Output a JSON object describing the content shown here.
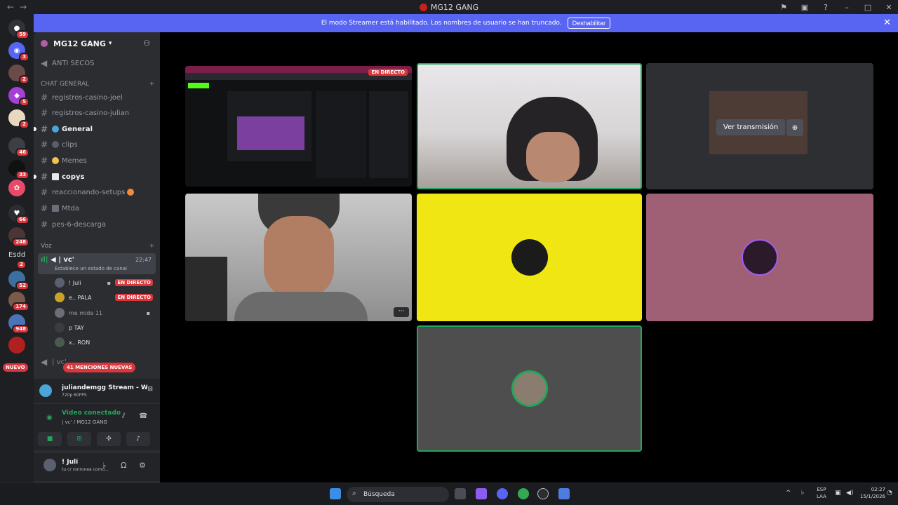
{
  "window": {
    "title": "MG12 GANG"
  },
  "banner": {
    "text": "El modo Streamer está habilitado. Los nombres de usuario se han truncado.",
    "button": "Deshabilitar"
  },
  "servers": {
    "badges": [
      "59",
      "3",
      "2",
      "5",
      "2",
      "46",
      "33",
      "66",
      "248",
      "2",
      "52",
      "174",
      "948"
    ],
    "text_server": "Esdd",
    "nuevo": "NUEVO"
  },
  "server": {
    "name": "MG12 GANG"
  },
  "channels": {
    "top": "ANTI SECOS",
    "category_chat": "CHAT GENERAL",
    "list": [
      {
        "label": "registros-casino-joel",
        "unread": false
      },
      {
        "label": "registros-casino-julian",
        "unread": false
      },
      {
        "label": "General",
        "unread": true
      },
      {
        "label": "clips",
        "unread": false
      },
      {
        "label": "Memes",
        "unread": false
      },
      {
        "label": "copys",
        "unread": true
      },
      {
        "label": "reaccionando-setups",
        "unread": false
      },
      {
        "label": "Mtda",
        "unread": false
      },
      {
        "label": "pes-6-descarga",
        "unread": false
      }
    ],
    "category_voice": "Voz"
  },
  "voice_channel": {
    "name": "| vc'",
    "time": "22:47",
    "status": "Establece un estado de canal",
    "next": "| vc'"
  },
  "voice_users": [
    {
      "name": "! Juli",
      "live": "EN DIRECTO",
      "color": "#5b6070"
    },
    {
      "name": "e.. PALA",
      "live": "EN DIRECTO",
      "color": "#c9a227"
    },
    {
      "name": "me mide 11",
      "live": "",
      "color": "#6d6f78"
    },
    {
      "name": "p TAY",
      "live": "",
      "color": "#3a3c42"
    },
    {
      "name": "x.. RON",
      "live": "",
      "color": "#4a5a4e"
    }
  ],
  "mentions": "41 MENCIONES NUEVAS",
  "stream_card": {
    "title": "juliandemgg Stream - Watch Li...",
    "quality": "720p 60FPS"
  },
  "voice_panel": {
    "title": "Video conectado",
    "subtitle": "| vc' / MG12 GANG"
  },
  "user_panel": {
    "name": "! Juli",
    "status": "tu cr ronronea como..."
  },
  "stage": {
    "live_tag": "EN DIRECTO",
    "watch": "Ver transmisión",
    "more": "···",
    "tile_colors": {
      "yellow": "#f0e614",
      "pink": "#9f5f74",
      "gray": "#4e4e4e"
    }
  },
  "taskbar": {
    "search": "Búsqueda",
    "lang_1": "ESP",
    "lang_2": "LAA",
    "time": "02:27",
    "date": "15/1/2026"
  },
  "accent": {
    "blurple": "#5865f2",
    "red": "#da373c",
    "green": "#23a55a"
  }
}
